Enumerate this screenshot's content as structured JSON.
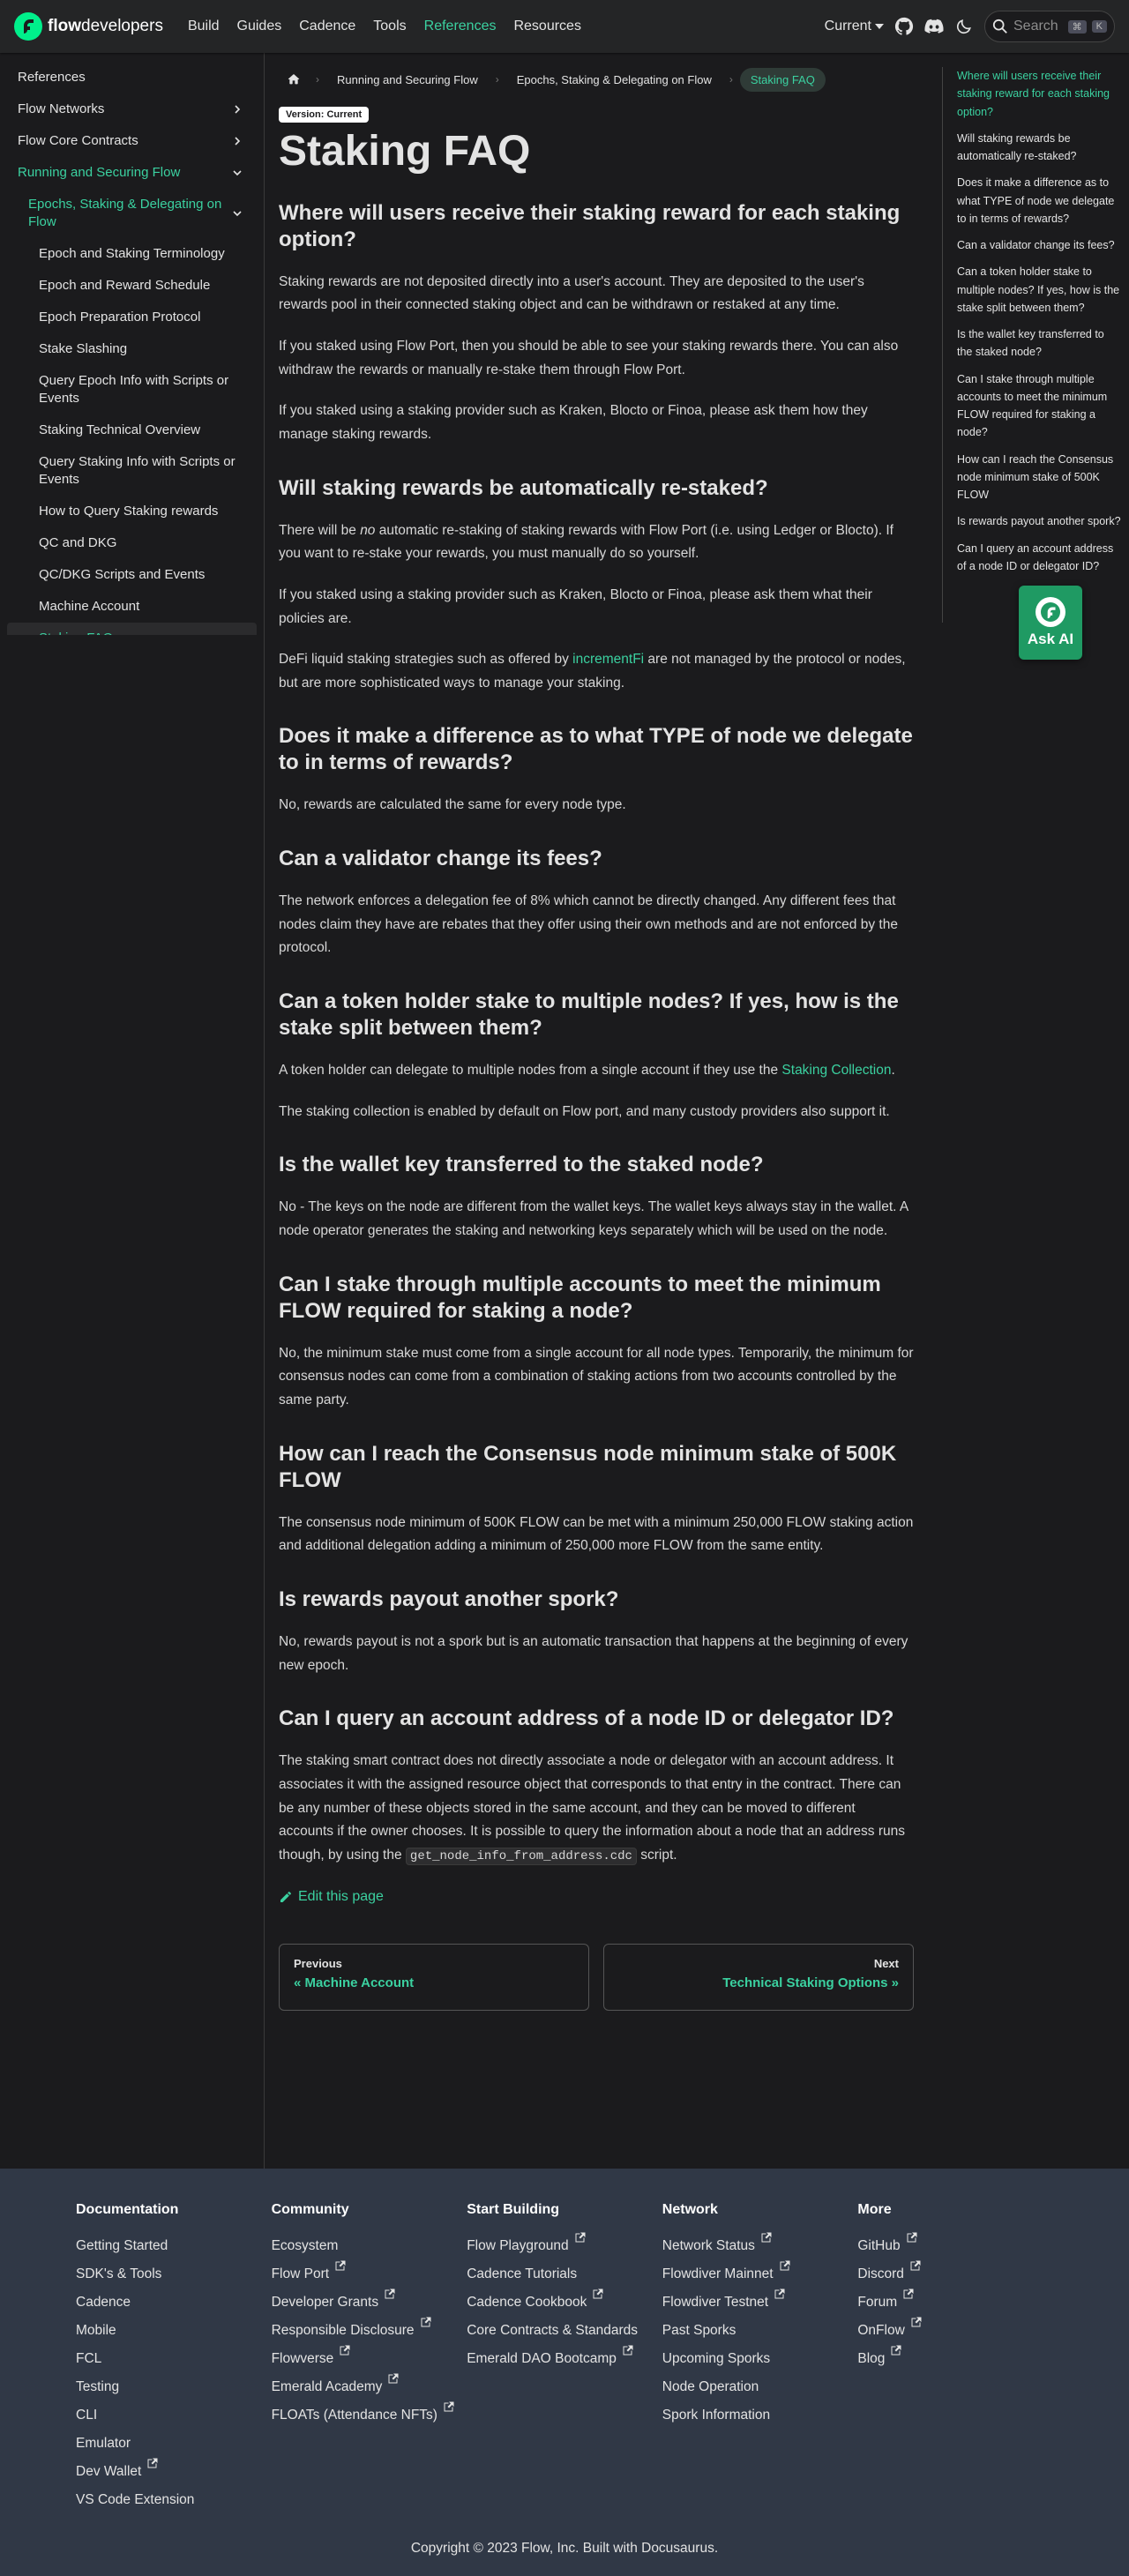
{
  "navbar": {
    "brand_bold": "flow",
    "brand_rest": "developers",
    "links": [
      {
        "label": "Build",
        "active": false
      },
      {
        "label": "Guides",
        "active": false
      },
      {
        "label": "Cadence",
        "active": false
      },
      {
        "label": "Tools",
        "active": false
      },
      {
        "label": "References",
        "active": true
      },
      {
        "label": "Resources",
        "active": false
      }
    ],
    "version_label": "Current",
    "search_placeholder": "Search",
    "kbd_1": "⌘",
    "kbd_2": "K"
  },
  "sidebar": {
    "items": [
      {
        "label": "References",
        "level": 0,
        "active": false,
        "chevron": "none"
      },
      {
        "label": "Flow Networks",
        "level": 0,
        "active": false,
        "chevron": "right"
      },
      {
        "label": "Flow Core Contracts",
        "level": 0,
        "active": false,
        "chevron": "right"
      },
      {
        "label": "Running and Securing Flow",
        "level": 0,
        "active": true,
        "chevron": "down"
      },
      {
        "label": "Epochs, Staking & Delegating on Flow",
        "level": 1,
        "active": true,
        "chevron": "down"
      },
      {
        "label": "Epoch and Staking Terminology",
        "level": 2,
        "active": false,
        "chevron": "none"
      },
      {
        "label": "Epoch and Reward Schedule",
        "level": 2,
        "active": false,
        "chevron": "none"
      },
      {
        "label": "Epoch Preparation Protocol",
        "level": 2,
        "active": false,
        "chevron": "none"
      },
      {
        "label": "Stake Slashing",
        "level": 2,
        "active": false,
        "chevron": "none"
      },
      {
        "label": "Query Epoch Info with Scripts or Events",
        "level": 2,
        "active": false,
        "chevron": "none"
      },
      {
        "label": "Staking Technical Overview",
        "level": 2,
        "active": false,
        "chevron": "none"
      },
      {
        "label": "Query Staking Info with Scripts or Events",
        "level": 2,
        "active": false,
        "chevron": "none"
      },
      {
        "label": "How to Query Staking rewards",
        "level": 2,
        "active": false,
        "chevron": "none"
      },
      {
        "label": "QC and DKG",
        "level": 2,
        "active": false,
        "chevron": "none"
      },
      {
        "label": "QC/DKG Scripts and Events",
        "level": 2,
        "active": false,
        "chevron": "none"
      },
      {
        "label": "Machine Account",
        "level": 2,
        "active": false,
        "chevron": "none"
      },
      {
        "label": "Staking FAQ",
        "level": 2,
        "active": true,
        "chevron": "none",
        "current": true
      }
    ]
  },
  "breadcrumbs": [
    "Running and Securing Flow",
    "Epochs, Staking & Delegating on Flow",
    "Staking FAQ"
  ],
  "version_badge": "Version: Current",
  "title": "Staking FAQ",
  "sections": [
    {
      "heading": "Where will users receive their staking reward for each staking option?",
      "paragraphs": [
        "Staking rewards are not deposited directly into a user's account. They are deposited to the user's rewards pool in their connected staking object and can be withdrawn or restaked at any time.",
        "If you staked using Flow Port, then you should be able to see your staking rewards there. You can also withdraw the rewards or manually re-stake them through Flow Port.",
        "If you staked using a staking provider such as Kraken, Blocto or Finoa, please ask them how they manage staking rewards."
      ]
    },
    {
      "heading": "Will staking rewards be automatically re-staked?",
      "p1_before": "There will be ",
      "p1_em": "no",
      "p1_after": " automatic re-staking of staking rewards with Flow Port (i.e. using Ledger or Blocto). If you want to re-stake your rewards, you must manually do so yourself.",
      "p2": "If you staked using a staking provider such as Kraken, Blocto or Finoa, please ask them what their policies are.",
      "p3_before": "DeFi liquid staking strategies such as offered by ",
      "p3_link": "incrementFi",
      "p3_after": " are not managed by the protocol or nodes, but are more sophisticated ways to manage your staking."
    },
    {
      "heading": "Does it make a difference as to what TYPE of node we delegate to in terms of rewards?",
      "paragraphs": [
        "No, rewards are calculated the same for every node type."
      ]
    },
    {
      "heading": "Can a validator change its fees?",
      "paragraphs": [
        "The network enforces a delegation fee of 8% which cannot be directly changed. Any different fees that nodes claim they have are rebates that they offer using their own methods and are not enforced by the protocol."
      ]
    },
    {
      "heading": "Can a token holder stake to multiple nodes? If yes, how is the stake split between them?",
      "p1_before": "A token holder can delegate to multiple nodes from a single account if they use the ",
      "p1_link": "Staking Collection",
      "p1_after": ".",
      "p2": "The staking collection is enabled by default on Flow port, and many custody providers also support it."
    },
    {
      "heading": "Is the wallet key transferred to the staked node?",
      "paragraphs": [
        "No - The keys on the node are different from the wallet keys. The wallet keys always stay in the wallet. A node operator generates the staking and networking keys separately which will be used on the node."
      ]
    },
    {
      "heading": "Can I stake through multiple accounts to meet the minimum FLOW required for staking a node?",
      "paragraphs": [
        "No, the minimum stake must come from a single account for all node types. Temporarily, the minimum for consensus nodes can come from a combination of staking actions from two accounts controlled by the same party."
      ]
    },
    {
      "heading": "How can I reach the Consensus node minimum stake of 500K FLOW",
      "paragraphs": [
        "The consensus node minimum of 500K FLOW can be met with a minimum 250,000 FLOW staking action and additional delegation adding a minimum of 250,000 more FLOW from the same entity."
      ]
    },
    {
      "heading": "Is rewards payout another spork?",
      "paragraphs": [
        "No, rewards payout is not a spork but is an automatic transaction that happens at the beginning of every new epoch."
      ]
    },
    {
      "heading": "Can I query an account address of a node ID or delegator ID?",
      "p1_before": "The staking smart contract does not directly associate a node or delegator with an account address. It associates it with the assigned resource object that corresponds to that entry in the contract. There can be any number of these objects stored in the same account, and they can be moved to different accounts if the owner chooses. It is possible to query the information about a node that an address runs though, by using the ",
      "p1_code": "get_node_info_from_address.cdc",
      "p1_after": " script."
    }
  ],
  "edit_label": "Edit this page",
  "pager": {
    "prev_sub": "Previous",
    "prev_label": "« Machine Account",
    "next_sub": "Next",
    "next_label": "Technical Staking Options »"
  },
  "toc": [
    {
      "label": "Where will users receive their staking reward for each staking option?",
      "active": true
    },
    {
      "label": "Will staking rewards be automatically re-staked?",
      "active": false
    },
    {
      "label": "Does it make a difference as to what TYPE of node we delegate to in terms of rewards?",
      "active": false
    },
    {
      "label": "Can a validator change its fees?",
      "active": false
    },
    {
      "label": "Can a token holder stake to multiple nodes? If yes, how is the stake split between them?",
      "active": false
    },
    {
      "label": "Is the wallet key transferred to the staked node?",
      "active": false
    },
    {
      "label": "Can I stake through multiple accounts to meet the minimum FLOW required for staking a node?",
      "active": false
    },
    {
      "label": "How can I reach the Consensus node minimum stake of 500K FLOW",
      "active": false
    },
    {
      "label": "Is rewards payout another spork?",
      "active": false
    },
    {
      "label": "Can I query an account address of a node ID or delegator ID?",
      "active": false
    }
  ],
  "ask_ai_label": "Ask AI",
  "footer": {
    "columns": [
      {
        "title": "Documentation",
        "links": [
          {
            "label": "Getting Started",
            "external": false
          },
          {
            "label": "SDK's & Tools",
            "external": false
          },
          {
            "label": "Cadence",
            "external": false
          },
          {
            "label": "Mobile",
            "external": false
          },
          {
            "label": "FCL",
            "external": false
          },
          {
            "label": "Testing",
            "external": false
          },
          {
            "label": "CLI",
            "external": false
          },
          {
            "label": "Emulator",
            "external": false
          },
          {
            "label": "Dev Wallet",
            "external": true
          },
          {
            "label": "VS Code Extension",
            "external": false
          }
        ]
      },
      {
        "title": "Community",
        "links": [
          {
            "label": "Ecosystem",
            "external": false
          },
          {
            "label": "Flow Port",
            "external": true
          },
          {
            "label": "Developer Grants",
            "external": true
          },
          {
            "label": "Responsible Disclosure",
            "external": true
          },
          {
            "label": "Flowverse",
            "external": true
          },
          {
            "label": "Emerald Academy",
            "external": true
          },
          {
            "label": "FLOATs (Attendance NFTs)",
            "external": true
          }
        ]
      },
      {
        "title": "Start Building",
        "links": [
          {
            "label": "Flow Playground",
            "external": true
          },
          {
            "label": "Cadence Tutorials",
            "external": false
          },
          {
            "label": "Cadence Cookbook",
            "external": true
          },
          {
            "label": "Core Contracts & Standards",
            "external": false
          },
          {
            "label": "Emerald DAO Bootcamp",
            "external": true
          }
        ]
      },
      {
        "title": "Network",
        "links": [
          {
            "label": "Network Status",
            "external": true
          },
          {
            "label": "Flowdiver Mainnet",
            "external": true
          },
          {
            "label": "Flowdiver Testnet",
            "external": true
          },
          {
            "label": "Past Sporks",
            "external": false
          },
          {
            "label": "Upcoming Sporks",
            "external": false
          },
          {
            "label": "Node Operation",
            "external": false
          },
          {
            "label": "Spork Information",
            "external": false
          }
        ]
      },
      {
        "title": "More",
        "links": [
          {
            "label": "GitHub",
            "external": true
          },
          {
            "label": "Discord",
            "external": true
          },
          {
            "label": "Forum",
            "external": true
          },
          {
            "label": "OnFlow",
            "external": true
          },
          {
            "label": "Blog",
            "external": true
          }
        ]
      }
    ],
    "copyright": "Copyright © 2023 Flow, Inc. Built with Docusaurus."
  },
  "colors": {
    "accent": "#3bd1a0",
    "background": "#1b1b1d",
    "navbar": "#242526",
    "footer": "#303846",
    "ask_ai": "#1f9a63"
  }
}
